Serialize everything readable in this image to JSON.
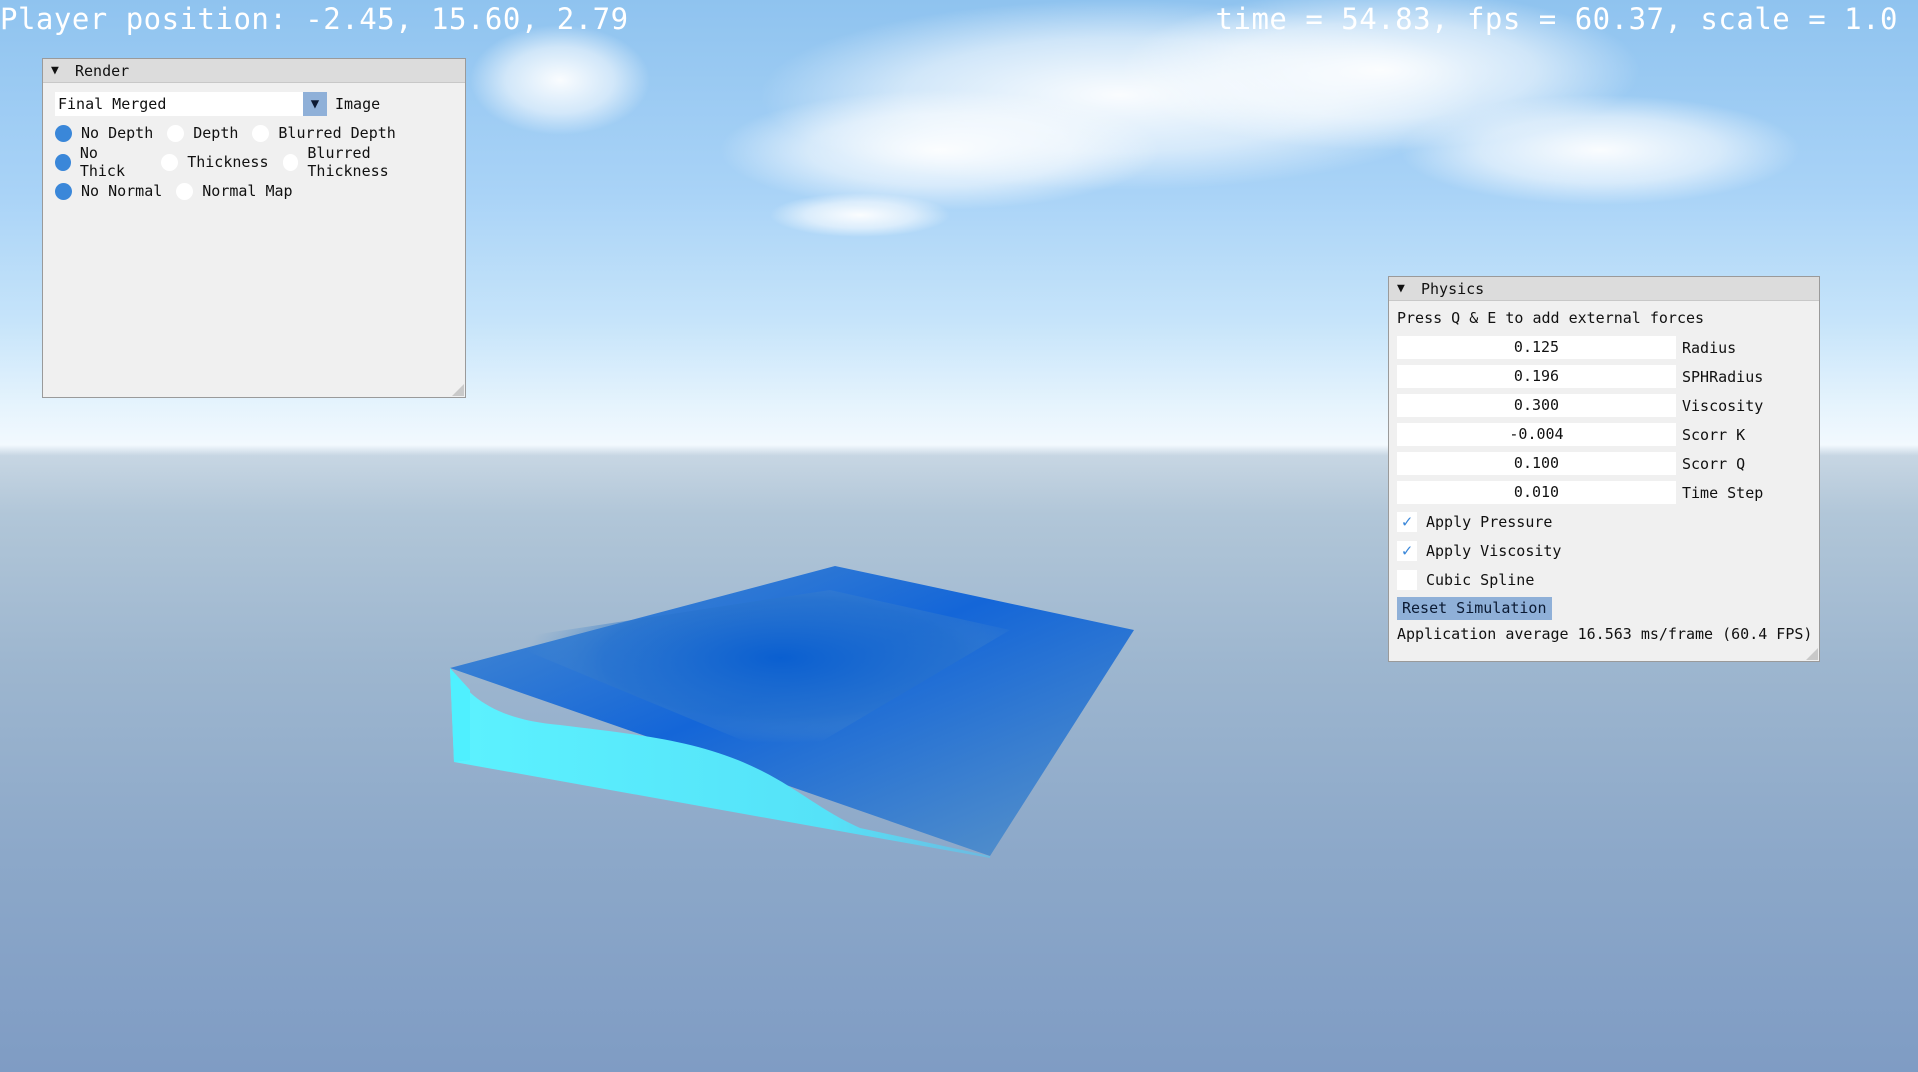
{
  "hud": {
    "player_position": "Player position: -2.45, 15.60, 2.79",
    "stats": "time = 54.83, fps = 60.37, scale = 1.0"
  },
  "render_panel": {
    "title": "Render",
    "combo": {
      "value": "Final Merged",
      "label": "Image"
    },
    "radio_groups": [
      {
        "options": [
          {
            "label": "No Depth",
            "selected": true
          },
          {
            "label": "Depth",
            "selected": false
          },
          {
            "label": "Blurred Depth",
            "selected": false
          }
        ]
      },
      {
        "options": [
          {
            "label": "No Thick",
            "selected": true
          },
          {
            "label": "Thickness",
            "selected": false
          },
          {
            "label": "Blurred Thickness",
            "selected": false
          }
        ]
      },
      {
        "options": [
          {
            "label": "No Normal",
            "selected": true
          },
          {
            "label": "Normal Map",
            "selected": false
          }
        ]
      }
    ]
  },
  "physics_panel": {
    "title": "Physics",
    "hint": "Press Q & E to add external forces",
    "fields": [
      {
        "value": "0.125",
        "label": "Radius"
      },
      {
        "value": "0.196",
        "label": "SPHRadius"
      },
      {
        "value": "0.300",
        "label": "Viscosity"
      },
      {
        "value": "-0.004",
        "label": "Scorr K"
      },
      {
        "value": "0.100",
        "label": "Scorr Q"
      },
      {
        "value": "0.010",
        "label": "Time Step"
      }
    ],
    "checkboxes": [
      {
        "label": "Apply Pressure",
        "checked": true
      },
      {
        "label": "Apply Viscosity",
        "checked": true
      },
      {
        "label": "Cubic Spline",
        "checked": false
      }
    ],
    "reset_button": "Reset Simulation",
    "average_text": "Application average 16.563 ms/frame (60.4 FPS)"
  },
  "colors": {
    "accent": "#3a87d9",
    "button": "#8fb0d8",
    "fluid_edge": "#5ff0ff",
    "fluid_deep": "#0a5fd0"
  },
  "icons": {
    "collapse": "triangle-down-icon",
    "checkmark": "check-icon"
  }
}
